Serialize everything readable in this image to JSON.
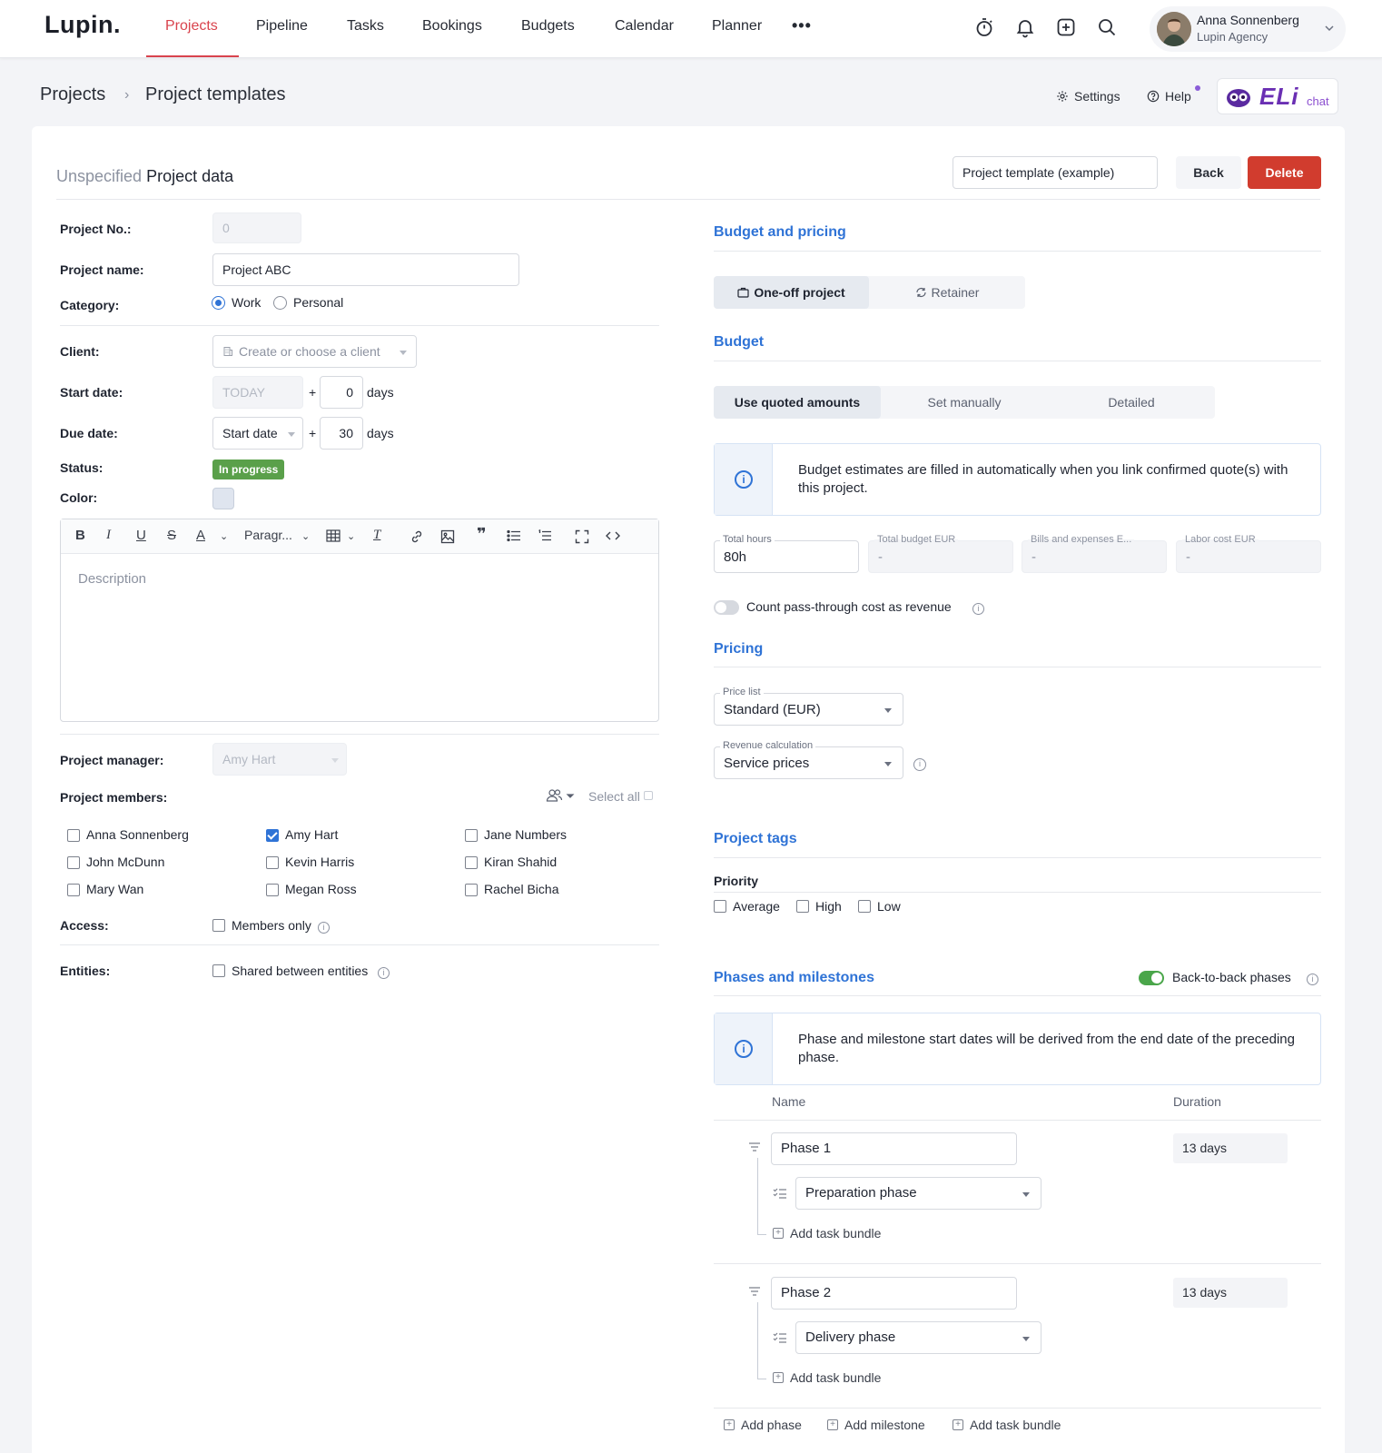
{
  "nav": {
    "logo": "Lupin.",
    "items": [
      "Projects",
      "Pipeline",
      "Tasks",
      "Bookings",
      "Budgets",
      "Calendar",
      "Planner"
    ],
    "more": "•••",
    "icons": [
      "stopwatch-icon",
      "bell-icon",
      "add-square-icon",
      "search-icon"
    ],
    "user": {
      "name": "Anna Sonnenberg",
      "org": "Lupin Agency"
    }
  },
  "breadcrumb": {
    "root": "Projects",
    "separator": "›",
    "current": "Project templates"
  },
  "utility": {
    "settings": "Settings",
    "help": "Help",
    "eli": "ELi",
    "eli_chat": "chat"
  },
  "header": {
    "prefix": "Unspecified",
    "title": "Project data",
    "template_value": "Project template (example)",
    "back": "Back",
    "delete": "Delete"
  },
  "form": {
    "project_no_label": "Project No.:",
    "project_no_value": "0",
    "project_name_label": "Project name:",
    "project_name_value": "Project ABC",
    "category_label": "Category:",
    "category_options": [
      "Work",
      "Personal"
    ],
    "category_selected": "Work",
    "client_label": "Client:",
    "client_placeholder": "Create or choose a client",
    "start_date_label": "Start date:",
    "start_date_base": "TODAY",
    "start_plus": "+",
    "start_offset": "0",
    "days": "days",
    "due_date_label": "Due date:",
    "due_date_base": "Start date",
    "due_offset": "30",
    "status_label": "Status:",
    "status_value": "In progress",
    "color_label": "Color:",
    "color_value": "#dfe5ef",
    "editor_paragraph": "Paragr...",
    "editor_placeholder": "Description",
    "pm_label": "Project manager:",
    "pm_value": "Amy Hart",
    "members_label": "Project members:",
    "select_all": "Select all",
    "members": [
      {
        "name": "Anna Sonnenberg",
        "checked": false
      },
      {
        "name": "Amy Hart",
        "checked": true
      },
      {
        "name": "Jane Numbers",
        "checked": false
      },
      {
        "name": "John McDunn",
        "checked": false
      },
      {
        "name": "Kevin Harris",
        "checked": false
      },
      {
        "name": "Kiran Shahid",
        "checked": false
      },
      {
        "name": "Mary Wan",
        "checked": false
      },
      {
        "name": "Megan Ross",
        "checked": false
      },
      {
        "name": "Rachel Bicha",
        "checked": false
      }
    ],
    "access_label": "Access:",
    "access_option": "Members only",
    "entities_label": "Entities:",
    "entities_option": "Shared between entities"
  },
  "budget": {
    "section_title": "Budget and pricing",
    "project_types": [
      "One-off project",
      "Retainer"
    ],
    "budget_title": "Budget",
    "budget_modes": [
      "Use quoted amounts",
      "Set manually",
      "Detailed"
    ],
    "info": "Budget estimates are filled in automatically when you link confirmed quote(s) with this project.",
    "total_hours_label": "Total hours",
    "total_hours_value": "80h",
    "total_budget_label": "Total budget EUR",
    "total_budget_value": "-",
    "bills_label": "Bills and expenses E...",
    "bills_value": "-",
    "labor_label": "Labor cost EUR",
    "labor_value": "-",
    "passthrough_label": "Count pass-through cost as revenue"
  },
  "pricing": {
    "title": "Pricing",
    "price_list_label": "Price list",
    "price_list_value": "Standard (EUR)",
    "revenue_label": "Revenue calculation",
    "revenue_value": "Service prices"
  },
  "tags": {
    "title": "Project tags",
    "priority_label": "Priority",
    "priority_options": [
      "Average",
      "High",
      "Low"
    ]
  },
  "phases": {
    "title": "Phases and milestones",
    "back_to_back": "Back-to-back phases",
    "info": "Phase and milestone start dates will be derived from the end date of the preceding phase.",
    "col_name": "Name",
    "col_duration": "Duration",
    "items": [
      {
        "name": "Phase 1",
        "duration": "13 days",
        "bundle": "Preparation phase",
        "add_bundle": "Add task bundle"
      },
      {
        "name": "Phase 2",
        "duration": "13 days",
        "bundle": "Delivery phase",
        "add_bundle": "Add task bundle"
      }
    ],
    "add_phase": "Add phase",
    "add_milestone": "Add milestone",
    "add_task_bundle": "Add task bundle"
  },
  "colors": {
    "accent": "#2f73d6",
    "nav_active": "#d9434d",
    "delete": "#d13c2e",
    "status": "#5aa04a",
    "toggle_on": "#4aa64a"
  }
}
